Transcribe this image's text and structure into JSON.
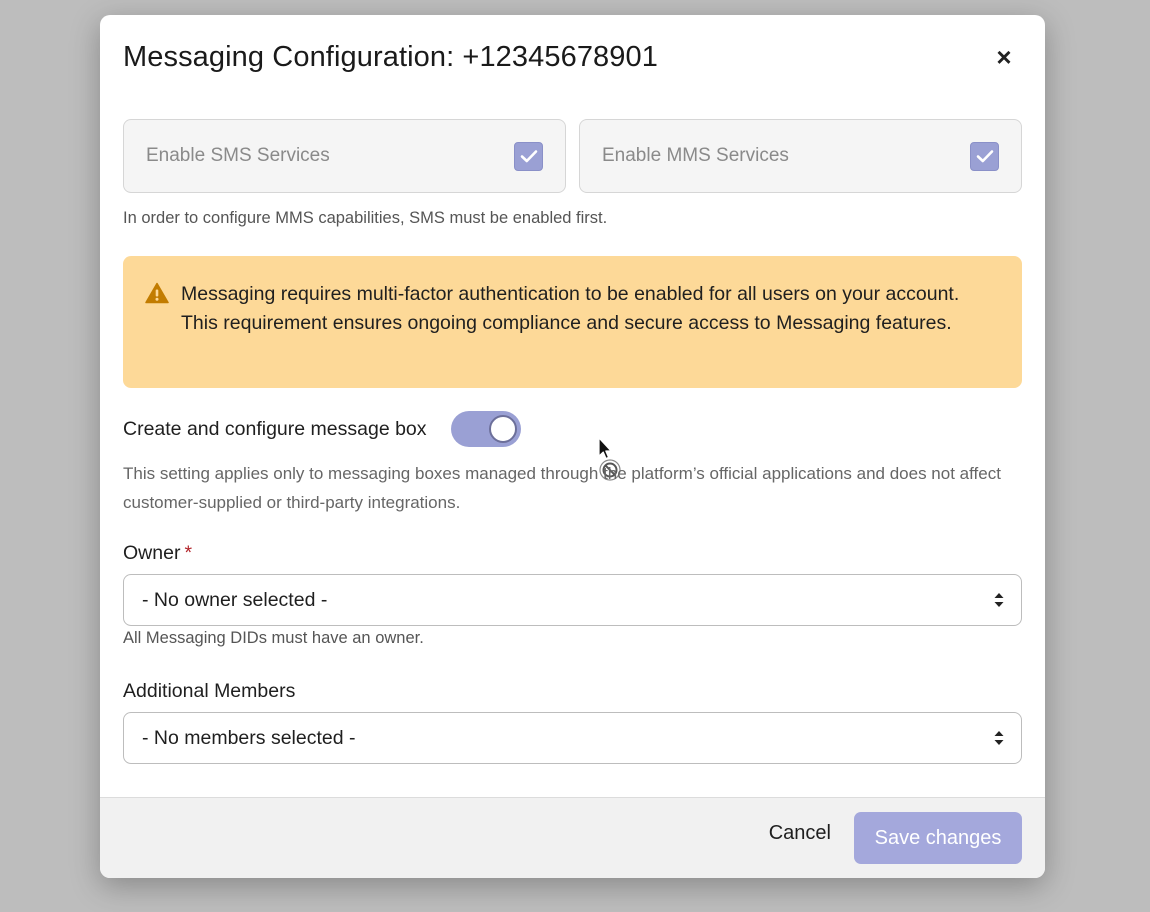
{
  "modal": {
    "title": "Messaging Configuration: +12345678901",
    "close_label": "×"
  },
  "services": {
    "sms": {
      "label": "Enable SMS Services",
      "checked": true
    },
    "mms": {
      "label": "Enable MMS Services",
      "checked": true
    },
    "helper": "In order to configure MMS capabilities, SMS must be enabled first."
  },
  "alert": {
    "icon": "warning-icon",
    "text": "Messaging requires multi-factor authentication to be enabled for all users on your account. This requirement ensures ongoing compliance and secure access to Messaging features."
  },
  "message_box": {
    "label": "Create and configure message box",
    "enabled": true,
    "description": "This setting applies only to messaging boxes managed through the platform’s official applications and does not affect customer-supplied or third-party integrations."
  },
  "owner": {
    "label": "Owner",
    "required_mark": "*",
    "selected": "- No owner selected -",
    "helper": "All Messaging DIDs must have an owner."
  },
  "members": {
    "label": "Additional Members",
    "selected": "- No members selected -"
  },
  "footer": {
    "cancel_label": "Cancel",
    "save_label": "Save changes"
  },
  "colors": {
    "accent": "#9aa0d4",
    "alert_bg": "#fdd998",
    "required": "#b3262c"
  }
}
